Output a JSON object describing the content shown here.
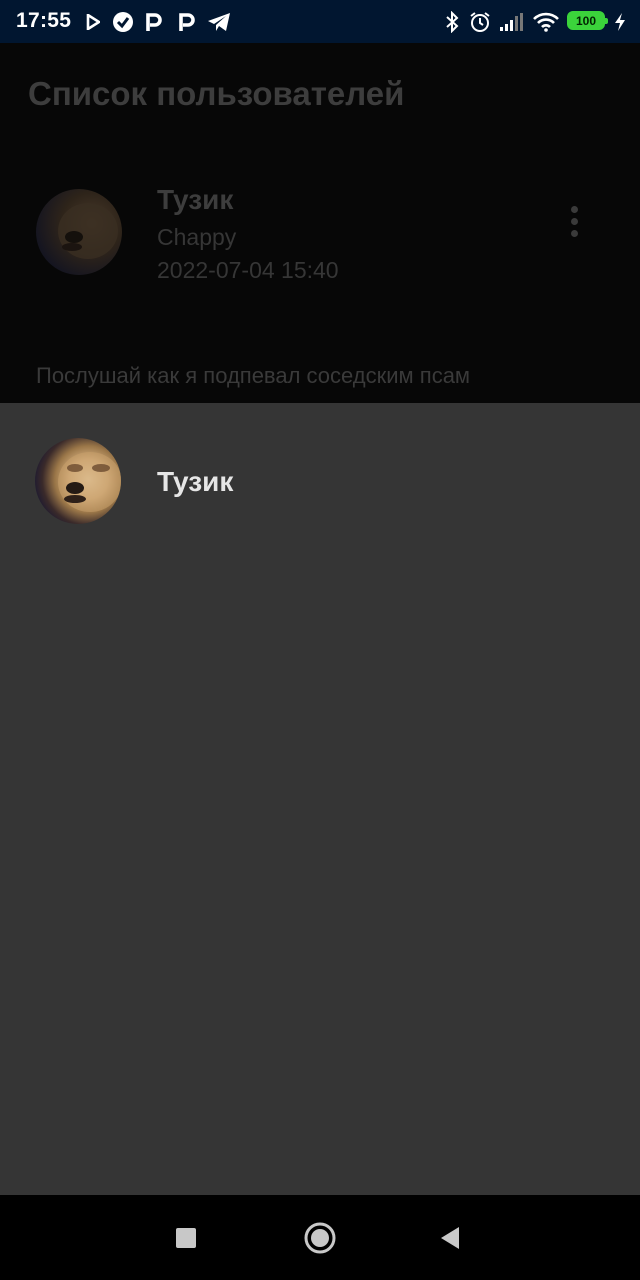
{
  "status_bar": {
    "time": "17:55",
    "left_icons": [
      "play-icon",
      "check-circle-icon",
      "p-icon",
      "p-icon",
      "telegram-icon"
    ],
    "right_icons": [
      "bluetooth-icon",
      "alarm-icon",
      "signal-icon",
      "wifi-icon"
    ],
    "battery": "100"
  },
  "screen": {
    "title": "Список пользователей",
    "post": {
      "name": "Тузик",
      "subtitle": "Chappy",
      "date": "2022-07-04 15:40",
      "text": "Послушай как я подпевал соседским псам"
    }
  },
  "sheet": {
    "user": {
      "name": "Тузик"
    }
  },
  "nav_bar": {
    "icons": [
      "recents-square-icon",
      "home-circle-icon",
      "back-triangle-icon"
    ]
  },
  "colors": {
    "status_bar_bg": "#011630",
    "sheet_bg": "#353535",
    "battery": "#3bd33b"
  }
}
